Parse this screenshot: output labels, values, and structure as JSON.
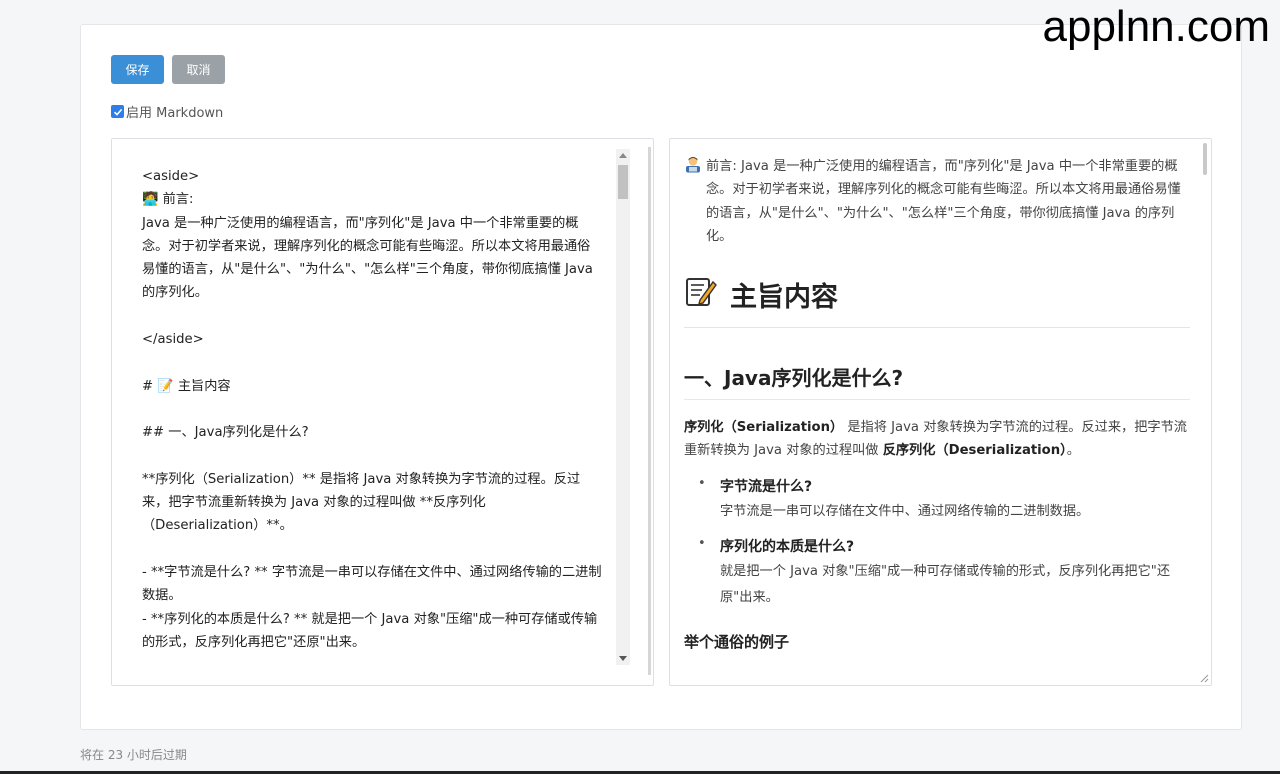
{
  "watermark": "applnn.com",
  "toolbar": {
    "save_label": "保存",
    "cancel_label": "取消"
  },
  "markdown_toggle": {
    "label": "启用 Markdown",
    "checked": true
  },
  "editor": {
    "text": "<aside>\n🧑‍💻 前言:\nJava 是一种广泛使用的编程语言，而\"序列化\"是 Java 中一个非常重要的概念。对于初学者来说，理解序列化的概念可能有些晦涩。所以本文将用最通俗易懂的语言，从\"是什么\"、\"为什么\"、\"怎么样\"三个角度，带你彻底搞懂 Java 的序列化。\n\n</aside>\n\n# 📝 主旨内容\n\n## 一、Java序列化是什么?\n\n**序列化（Serialization）** 是指将 Java 对象转换为字节流的过程。反过来，把字节流重新转换为 Java 对象的过程叫做 **反序列化（Deserialization）**。\n\n- **字节流是什么? ** 字节流是一串可以存储在文件中、通过网络传输的二进制数据。\n- **序列化的本质是什么? ** 就是把一个 Java 对象\"压缩\"成一种可存储或传输的形式，反序列化再把它\"还原\"出来。"
  },
  "preview": {
    "intro_label": "前言:",
    "intro_text": "Java 是一种广泛使用的编程语言，而\"序列化\"是 Java 中一个非常重要的概念。对于初学者来说，理解序列化的概念可能有些晦涩。所以本文将用最通俗易懂的语言，从\"是什么\"、\"为什么\"、\"怎么样\"三个角度，带你彻底搞懂 Java 的序列化。",
    "h1": "主旨内容",
    "h2": "一、Java序列化是什么?",
    "p_term1": "序列化（Serialization）",
    "p_mid": " 是指将 Java 对象转换为字节流的过程。反过来，把字节流重新转换为 Java 对象的过程叫做 ",
    "p_term2": "反序列化（Deserialization）",
    "p_end": "。",
    "list": [
      {
        "q": "字节流是什么?",
        "a": "字节流是一串可以存储在文件中、通过网络传输的二进制数据。"
      },
      {
        "q": "序列化的本质是什么?",
        "a": "就是把一个 Java 对象\"压缩\"成一种可存储或传输的形式，反序列化再把它\"还原\"出来。"
      }
    ],
    "h3": "举个通俗的例子"
  },
  "footer": {
    "expiry": "将在 23 小时后过期"
  }
}
